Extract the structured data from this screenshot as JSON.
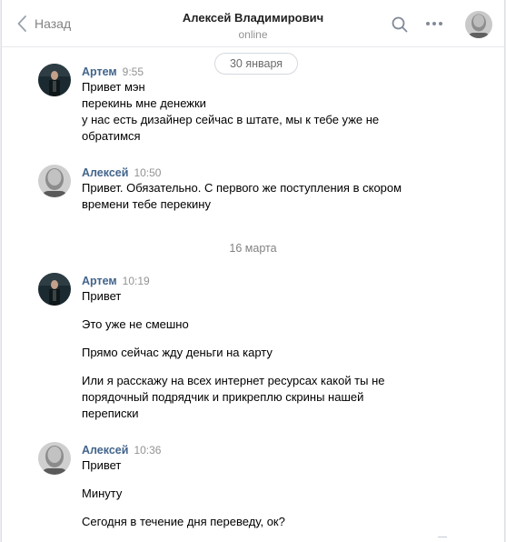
{
  "header": {
    "back_label": "Назад",
    "title": "Алексей Владимирович",
    "status": "online"
  },
  "dates": {
    "first": "30 января",
    "second": "16 марта"
  },
  "messages": [
    {
      "author": "Артем",
      "time": "9:55",
      "lines": [
        "Привет мэн",
        "перекинь мне денежки",
        "у нас есть дизайнер сейчас в штате, мы к тебе уже не",
        "обратимся"
      ]
    },
    {
      "author": "Алексей",
      "time": "10:50",
      "lines": [
        "Привет. Обязательно. С первого же поступления в скором",
        "времени тебе перекину"
      ]
    },
    {
      "author": "Артем",
      "time": "10:19",
      "lines": [
        "Привет",
        "Это уже не смешно",
        "Прямо сейчас жду деньги на карту",
        "Или я расскажу на всех интернет ресурсах какой ты не",
        "порядочный подрядчик и прикреплю скрины нашей",
        "переписки"
      ]
    },
    {
      "author": "Алексей",
      "time": "10:36",
      "lines": [
        "Привет",
        "Минуту",
        "Сегодня в течение дня переведу, ок?"
      ]
    }
  ],
  "colors": {
    "author_link": "#42648b",
    "muted": "#939393",
    "border": "#e7e8ec"
  }
}
